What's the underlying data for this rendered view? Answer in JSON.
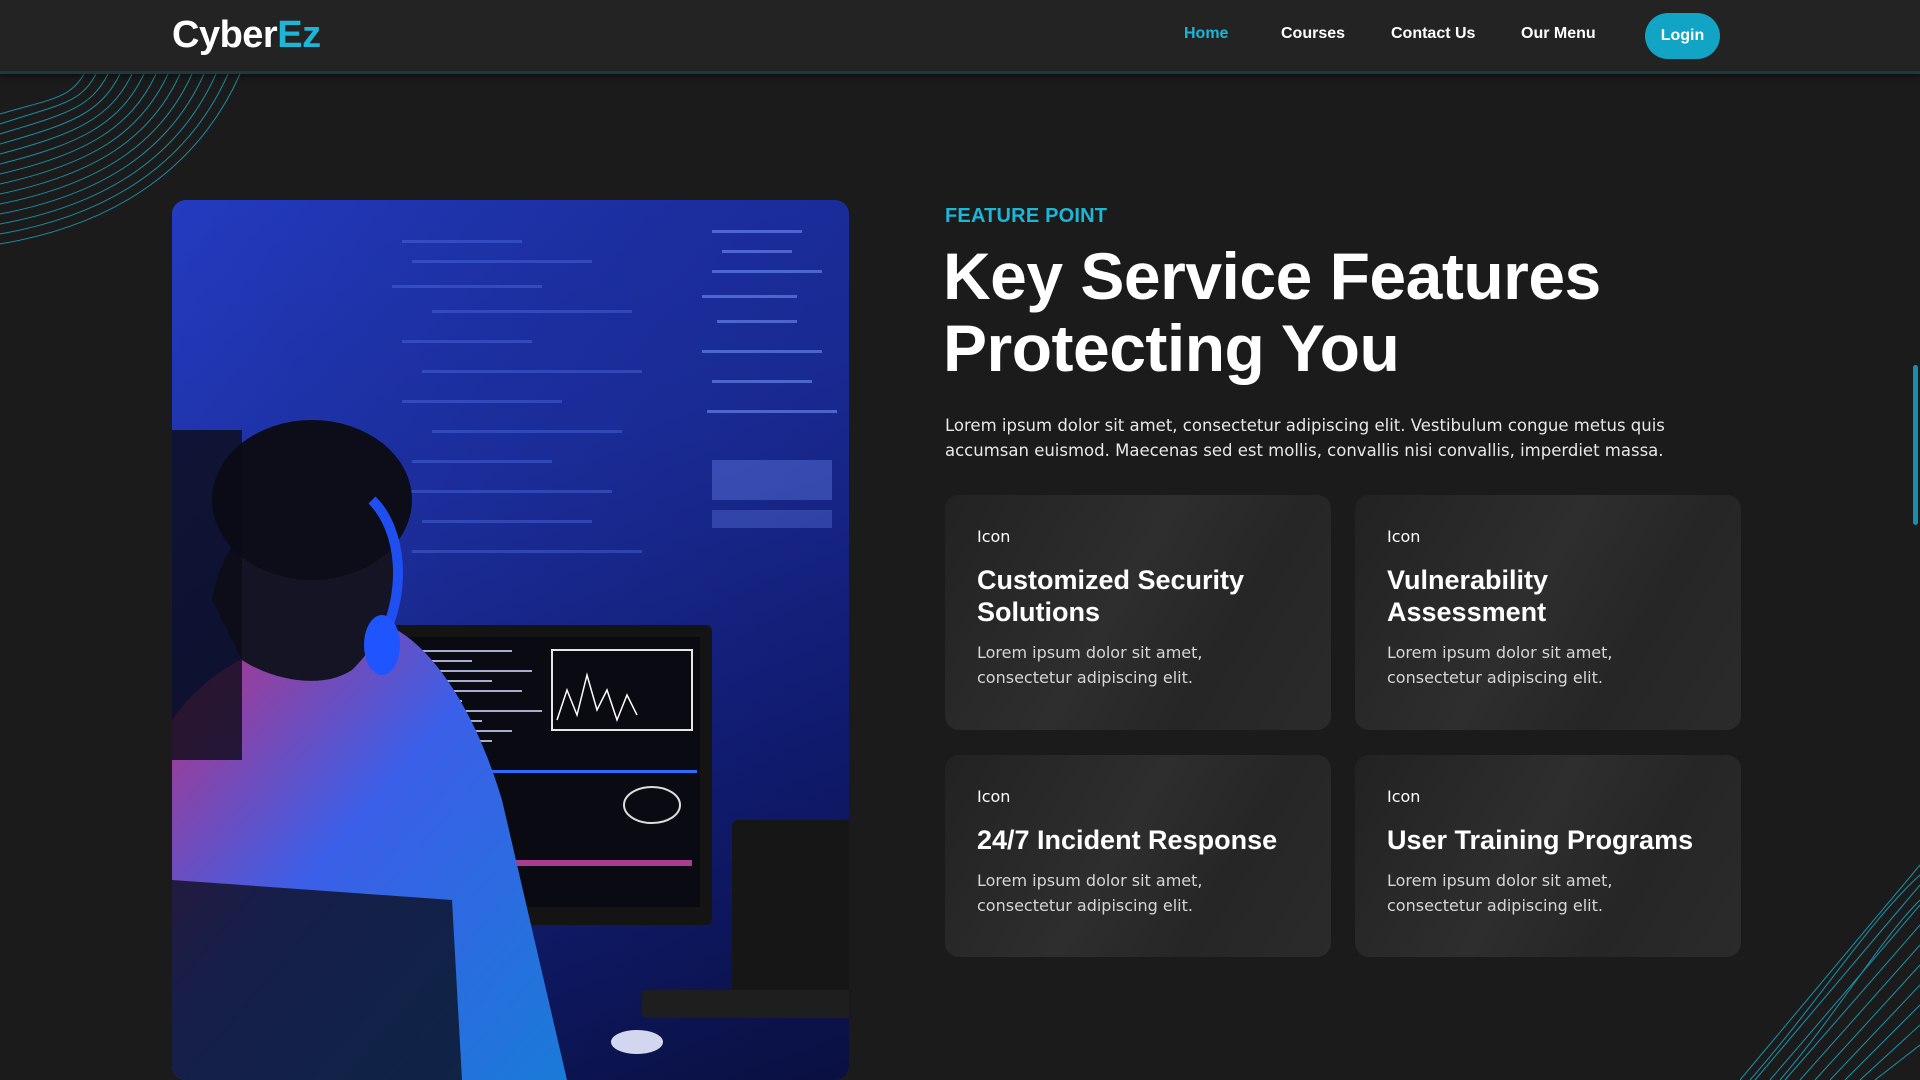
{
  "brand": {
    "name_part1": "Cyber",
    "name_part2": "Ez",
    "accent_color": "#1eb6d6"
  },
  "nav": {
    "items": [
      {
        "label": "Home",
        "active": true
      },
      {
        "label": "Courses",
        "active": false
      },
      {
        "label": "Contact Us",
        "active": false
      },
      {
        "label": "Our Menu",
        "active": false
      }
    ],
    "login_label": "Login"
  },
  "section": {
    "eyebrow": "FEATURE POINT",
    "title_line1": "Key Service Features",
    "title_line2": "Protecting You",
    "intro": "Lorem ipsum dolor sit amet, consectetur adipiscing elit. Vestibulum congue metus quis accumsan euismod. Maecenas sed est mollis, convallis nisi convallis, imperdiet massa."
  },
  "features": [
    {
      "icon_text": "Icon",
      "title": "Customized Security Solutions",
      "text": "Lorem ipsum dolor sit amet, consectetur adipiscing elit."
    },
    {
      "icon_text": "Icon",
      "title": "Vulnerability Assessment",
      "text": "Lorem ipsum dolor sit amet, consectetur adipiscing elit."
    },
    {
      "icon_text": "Icon",
      "title": "24/7 Incident Response",
      "text": "Lorem ipsum dolor sit amet, consectetur adipiscing elit."
    },
    {
      "icon_text": "Icon",
      "title": "User Training Programs",
      "text": "Lorem ipsum dolor sit amet, consectetur adipiscing elit."
    }
  ],
  "hero_image": {
    "subject": "person-at-computer-photo"
  },
  "colors": {
    "background": "#1b1b1b",
    "header": "#232323",
    "accent": "#1eb6d6",
    "button": "#12a4c4",
    "card": "#2a2a2a"
  }
}
